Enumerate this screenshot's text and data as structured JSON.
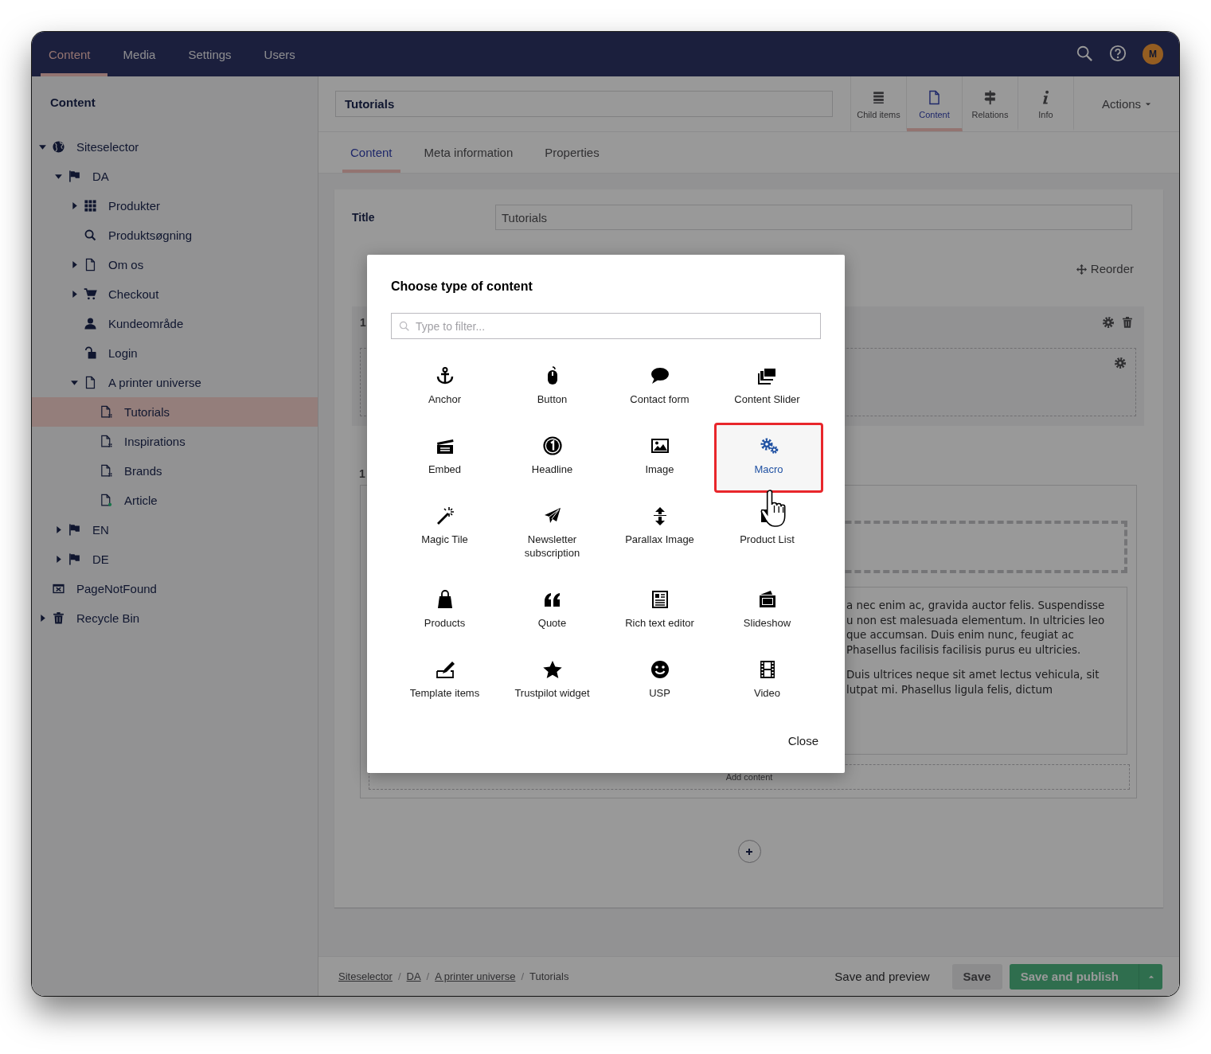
{
  "top_nav": {
    "items": [
      {
        "label": "Content",
        "selected": true
      },
      {
        "label": "Media",
        "selected": false
      },
      {
        "label": "Settings",
        "selected": false
      },
      {
        "label": "Users",
        "selected": false
      }
    ],
    "avatar": "M"
  },
  "sidebar": {
    "title": "Content",
    "tree": [
      {
        "label": "Siteselector",
        "kind": "globe",
        "expanded": true,
        "selected": false,
        "children": [
          {
            "label": "DA",
            "kind": "flag",
            "expanded": true,
            "selected": false,
            "children": [
              {
                "label": "Produkter",
                "kind": "grid",
                "expanded": false,
                "selected": false
              },
              {
                "label": "Produktsøgning",
                "kind": "search",
                "selected": false
              },
              {
                "label": "Om os",
                "kind": "page",
                "expanded": false,
                "selected": false
              },
              {
                "label": "Checkout",
                "kind": "cart",
                "expanded": false,
                "selected": false
              },
              {
                "label": "Kundeområde",
                "kind": "user",
                "selected": false
              },
              {
                "label": "Login",
                "kind": "lock",
                "selected": false
              },
              {
                "label": "A printer universe",
                "kind": "page",
                "expanded": true,
                "selected": false,
                "children": [
                  {
                    "label": "Tutorials",
                    "kind": "pagegrid",
                    "selected": true
                  },
                  {
                    "label": "Inspirations",
                    "kind": "pagegrid",
                    "selected": false
                  },
                  {
                    "label": "Brands",
                    "kind": "pagegrid",
                    "selected": false
                  },
                  {
                    "label": "Article",
                    "kind": "pagedot",
                    "selected": false
                  }
                ]
              }
            ]
          },
          {
            "label": "EN",
            "kind": "flag",
            "expanded": false,
            "selected": false
          },
          {
            "label": "DE",
            "kind": "flag",
            "expanded": false,
            "selected": false
          }
        ]
      },
      {
        "label": "PageNotFound",
        "kind": "window",
        "selected": false
      },
      {
        "label": "Recycle Bin",
        "kind": "trash",
        "expanded": false,
        "selected": false
      }
    ]
  },
  "header": {
    "name_value": "Tutorials",
    "apps": [
      {
        "label": "Child items",
        "kind": "list",
        "selected": false
      },
      {
        "label": "Content",
        "kind": "page",
        "selected": true
      },
      {
        "label": "Relations",
        "kind": "signpost",
        "selected": false
      },
      {
        "label": "Info",
        "kind": "info",
        "selected": false
      }
    ],
    "actions": "Actions"
  },
  "sub_tabs": [
    {
      "label": "Content",
      "selected": true
    },
    {
      "label": "Meta information",
      "selected": false
    },
    {
      "label": "Properties",
      "selected": false
    }
  ],
  "editor": {
    "title_label": "Title",
    "title_value": "Tutorials",
    "reorder": "Reorder",
    "rows": [
      {
        "number": "1"
      },
      {
        "number": "1"
      }
    ],
    "text_paragraphs": [
      [
        "a nec enim ac, gravida auctor felis. Suspendisse",
        "u non est malesuada elementum. In ultricies leo",
        "que accumsan. Duis enim nunc, feugiat ac",
        "Phasellus facilisis facilisis purus eu ultricies."
      ],
      [
        "Duis ultrices neque sit amet lectus vehicula, sit",
        "lutpat mi. Phasellus ligula felis, dictum"
      ]
    ],
    "add_content": "Add content"
  },
  "footer": {
    "breadcrumbs": [
      {
        "label": "Siteselector",
        "link": true
      },
      {
        "label": "DA",
        "link": true
      },
      {
        "label": "A printer universe",
        "link": true
      },
      {
        "label": "Tutorials",
        "link": false
      }
    ],
    "separator": "/",
    "save_preview": "Save and preview",
    "save": "Save",
    "publish": "Save and publish"
  },
  "dialog": {
    "title": "Choose type of content",
    "filter_placeholder": "Type to filter...",
    "items": [
      {
        "label": "Anchor",
        "kind": "anchor",
        "selected": false
      },
      {
        "label": "Button",
        "kind": "mouse",
        "selected": false
      },
      {
        "label": "Contact form",
        "kind": "chat",
        "selected": false
      },
      {
        "label": "Content Slider",
        "kind": "stack",
        "selected": false
      },
      {
        "label": "Embed",
        "kind": "clapper",
        "selected": false
      },
      {
        "label": "Headline",
        "kind": "one",
        "selected": false
      },
      {
        "label": "Image",
        "kind": "picture",
        "selected": false
      },
      {
        "label": "Macro",
        "kind": "gears",
        "selected": true
      },
      {
        "label": "Magic Tile",
        "kind": "wand",
        "selected": false
      },
      {
        "label": "Newsletter subscription",
        "kind": "plane",
        "selected": false
      },
      {
        "label": "Parallax Image",
        "kind": "updown",
        "selected": false
      },
      {
        "label": "Product List",
        "kind": "block",
        "selected": false
      },
      {
        "label": "Products",
        "kind": "bag",
        "selected": false
      },
      {
        "label": "Quote",
        "kind": "quote",
        "selected": false
      },
      {
        "label": "Rich text editor",
        "kind": "news",
        "selected": false
      },
      {
        "label": "Slideshow",
        "kind": "slides",
        "selected": false
      },
      {
        "label": "Template items",
        "kind": "pencil",
        "selected": false
      },
      {
        "label": "Trustpilot widget",
        "kind": "star",
        "selected": false
      },
      {
        "label": "USP",
        "kind": "smile",
        "selected": false
      },
      {
        "label": "Video",
        "kind": "film",
        "selected": false
      }
    ],
    "close": "Close"
  }
}
